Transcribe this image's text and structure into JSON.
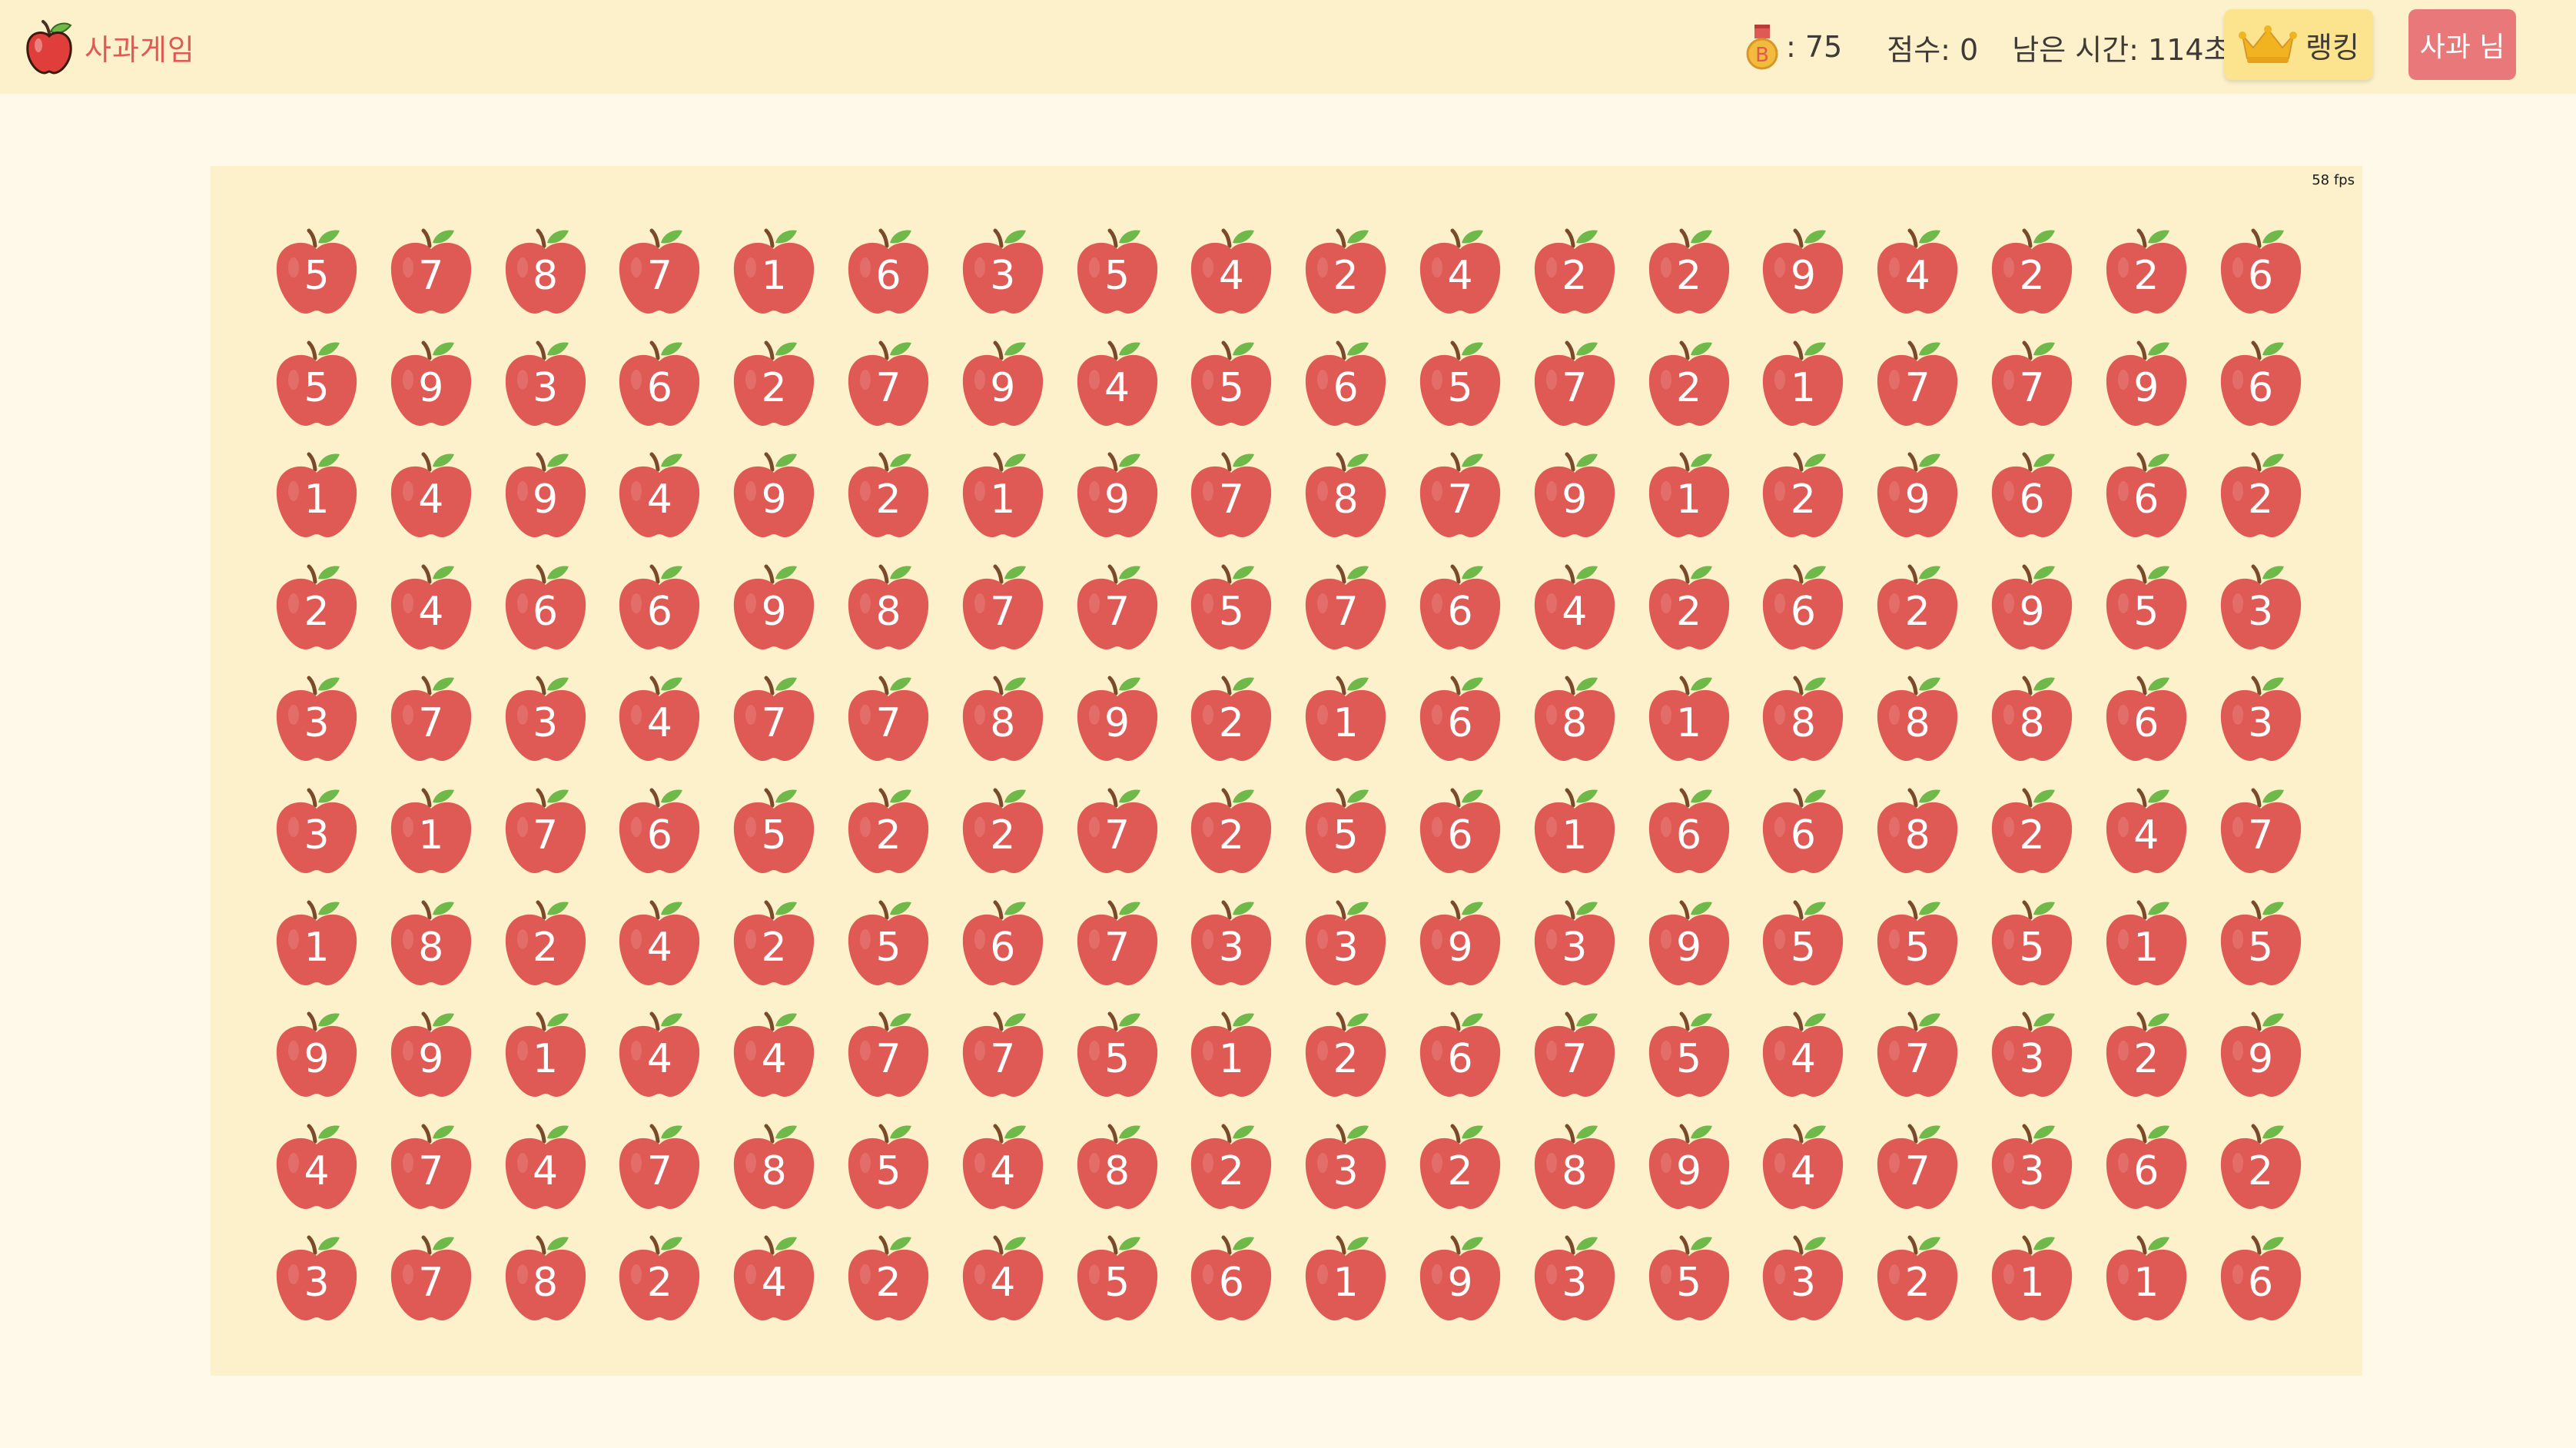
{
  "header": {
    "title": "사과게임",
    "logo_icon": "apple-icon",
    "medal_icon": "bronze-medal-icon",
    "medal_letter": "B",
    "medal_text": ": 75",
    "score_text": "점수: 0",
    "timer_text": "남은 시간: 114초",
    "ranking_icon": "crown-icon",
    "ranking_label": "랭킹",
    "user_label": "사과 님"
  },
  "board": {
    "fps_text": "58 fps",
    "grid": [
      [
        5,
        7,
        8,
        7,
        1,
        6,
        3,
        5,
        4,
        2,
        4,
        2,
        2,
        9,
        4,
        2,
        2,
        6
      ],
      [
        5,
        9,
        3,
        6,
        2,
        7,
        9,
        4,
        5,
        6,
        5,
        7,
        2,
        1,
        7,
        7,
        9,
        6
      ],
      [
        1,
        4,
        9,
        4,
        9,
        2,
        1,
        9,
        7,
        8,
        7,
        9,
        1,
        2,
        9,
        6,
        6,
        2
      ],
      [
        2,
        4,
        6,
        6,
        9,
        8,
        7,
        7,
        5,
        7,
        6,
        4,
        2,
        6,
        2,
        9,
        5,
        3
      ],
      [
        3,
        7,
        3,
        4,
        7,
        7,
        8,
        9,
        2,
        1,
        6,
        8,
        1,
        8,
        8,
        8,
        6,
        3
      ],
      [
        3,
        1,
        7,
        6,
        5,
        2,
        2,
        7,
        2,
        5,
        6,
        1,
        6,
        6,
        8,
        2,
        4,
        7
      ],
      [
        1,
        8,
        2,
        4,
        2,
        5,
        6,
        7,
        3,
        3,
        9,
        3,
        9,
        5,
        5,
        5,
        1,
        5
      ],
      [
        9,
        9,
        1,
        4,
        4,
        7,
        7,
        5,
        1,
        2,
        6,
        7,
        5,
        4,
        7,
        3,
        2,
        9
      ],
      [
        4,
        7,
        4,
        7,
        8,
        5,
        4,
        8,
        2,
        3,
        2,
        8,
        9,
        4,
        7,
        3,
        6,
        2
      ],
      [
        3,
        7,
        8,
        2,
        4,
        2,
        4,
        5,
        6,
        1,
        9,
        3,
        5,
        3,
        2,
        1,
        1,
        6
      ]
    ]
  },
  "colors": {
    "apple": "#e05a55",
    "leaf": "#6fb84a",
    "stem": "#7a4a2a",
    "board_bg": "#fcf1cb",
    "user_button": "#e8787a",
    "ranking_button": "#fce48f"
  }
}
